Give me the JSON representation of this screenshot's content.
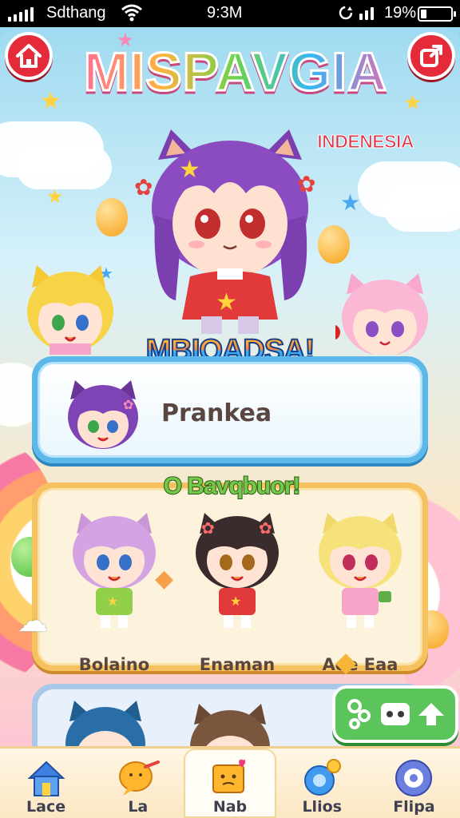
{
  "status_bar": {
    "carrier": "Sdthang",
    "time": "9:3M",
    "battery_percent": "19%",
    "battery_level": 0.19
  },
  "header": {
    "home_icon": "home-icon",
    "share_icon": "share-icon",
    "logo_title": "MISPAVGIA",
    "logo_subtitle": "INDENESIA"
  },
  "banner": {
    "title": "MBIOADSA!"
  },
  "player": {
    "name": "Prankea"
  },
  "friends": {
    "title": "O Bavqbuor!",
    "items": [
      {
        "name": "Bolaino"
      },
      {
        "name": "Enaman"
      },
      {
        "name": "Aoe Eaa"
      }
    ]
  },
  "tabs": [
    {
      "label": "Lace",
      "icon": "house-icon",
      "active": false
    },
    {
      "label": "La",
      "icon": "chat-bubble-icon",
      "active": false
    },
    {
      "label": "Nab",
      "icon": "toy-box-icon",
      "active": true
    },
    {
      "label": "Llios",
      "icon": "magic-orb-icon",
      "active": false
    },
    {
      "label": "Flipa",
      "icon": "gear-icon",
      "active": false
    }
  ],
  "colors": {
    "accent_red": "#e52b3a",
    "player_card": "#5db8ea",
    "friends_card": "#f6c15f",
    "action_green": "#5bc45a"
  }
}
